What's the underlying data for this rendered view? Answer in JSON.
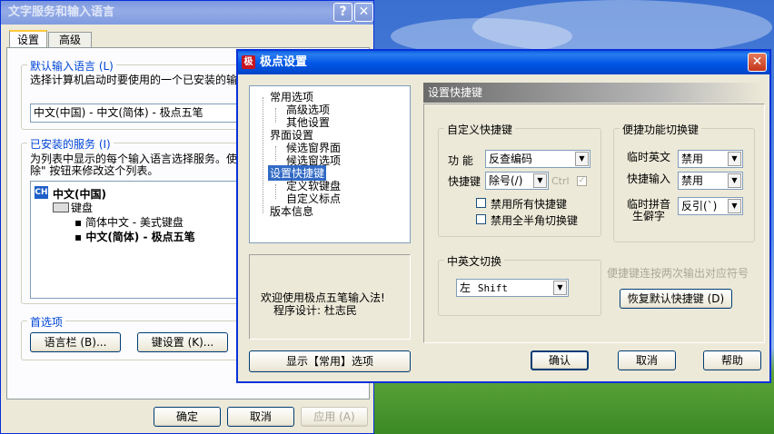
{
  "desktop": {
    "bg": "#3a6fd0"
  },
  "back_window": {
    "title": "文字服务和输入语言",
    "tabs": [
      "设置",
      "高级"
    ],
    "default_lang": {
      "group_title": "默认输入语言 (L)",
      "desc": "选择计算机启动时要使用的一个已安装的输",
      "value": "中文(中国) - 中文(简体) - 极点五笔"
    },
    "installed": {
      "group_title": "已安装的服务 (I)",
      "desc1": "为列表中显示的每个输入语言选择服务。使",
      "desc2": "除\" 按钮来修改这个列表。",
      "ch_badge": "CH",
      "lang": "中文(中国)",
      "keyboard": "键盘",
      "items": [
        "简体中文 - 美式键盘",
        "中文(简体) - 极点五笔"
      ]
    },
    "prefs": {
      "group_title": "首选项",
      "language_bar": "语言栏 (B)...",
      "key_settings": "键设置 (K)..."
    },
    "buttons": {
      "ok": "确定",
      "cancel": "取消",
      "apply": "应用 (A)"
    }
  },
  "front_window": {
    "title": "极点设置",
    "title_icon_char": "极",
    "tree": [
      "常用选项",
      "高级选项",
      "其他设置",
      "界面设置",
      "候选窗界面",
      "候选窗选项",
      "设置快捷键",
      "定义软键盘",
      "自定义标点",
      "版本信息"
    ],
    "welcome_line1": "欢迎使用极点五笔输入法!",
    "welcome_line2": "程序设计: 杜志民",
    "show_common_button": "显示【常用】选项",
    "section_header": "设置快捷键",
    "custom_hotkeys": {
      "group_title": "自定义快捷键",
      "function_label": "功 能",
      "function_value": "反查编码",
      "hotkey_label": "快捷键",
      "hotkey_value": "除号(/)",
      "ctrl_label": "Ctrl",
      "disable_all": "禁用所有快捷键",
      "disable_fullwidth": "禁用全半角切换键"
    },
    "quick_switch": {
      "group_title": "便捷功能切换键",
      "temp_english_label": "临时英文",
      "temp_english_value": "禁用",
      "quick_input_label": "快捷输入",
      "quick_input_value": "禁用",
      "temp_pinyin_label1": "临时拼音",
      "temp_pinyin_label2": "生僻字",
      "temp_pinyin_value": "反引(`)"
    },
    "cn_en_switch": {
      "group_title": "中英文切换",
      "value_side": "左",
      "value_key": "Shift"
    },
    "hint": "便捷键连按两次输出对应符号",
    "restore_button": "恢复默认快捷键 (D)",
    "buttons": {
      "ok": "确认",
      "cancel": "取消",
      "help": "帮助"
    }
  }
}
